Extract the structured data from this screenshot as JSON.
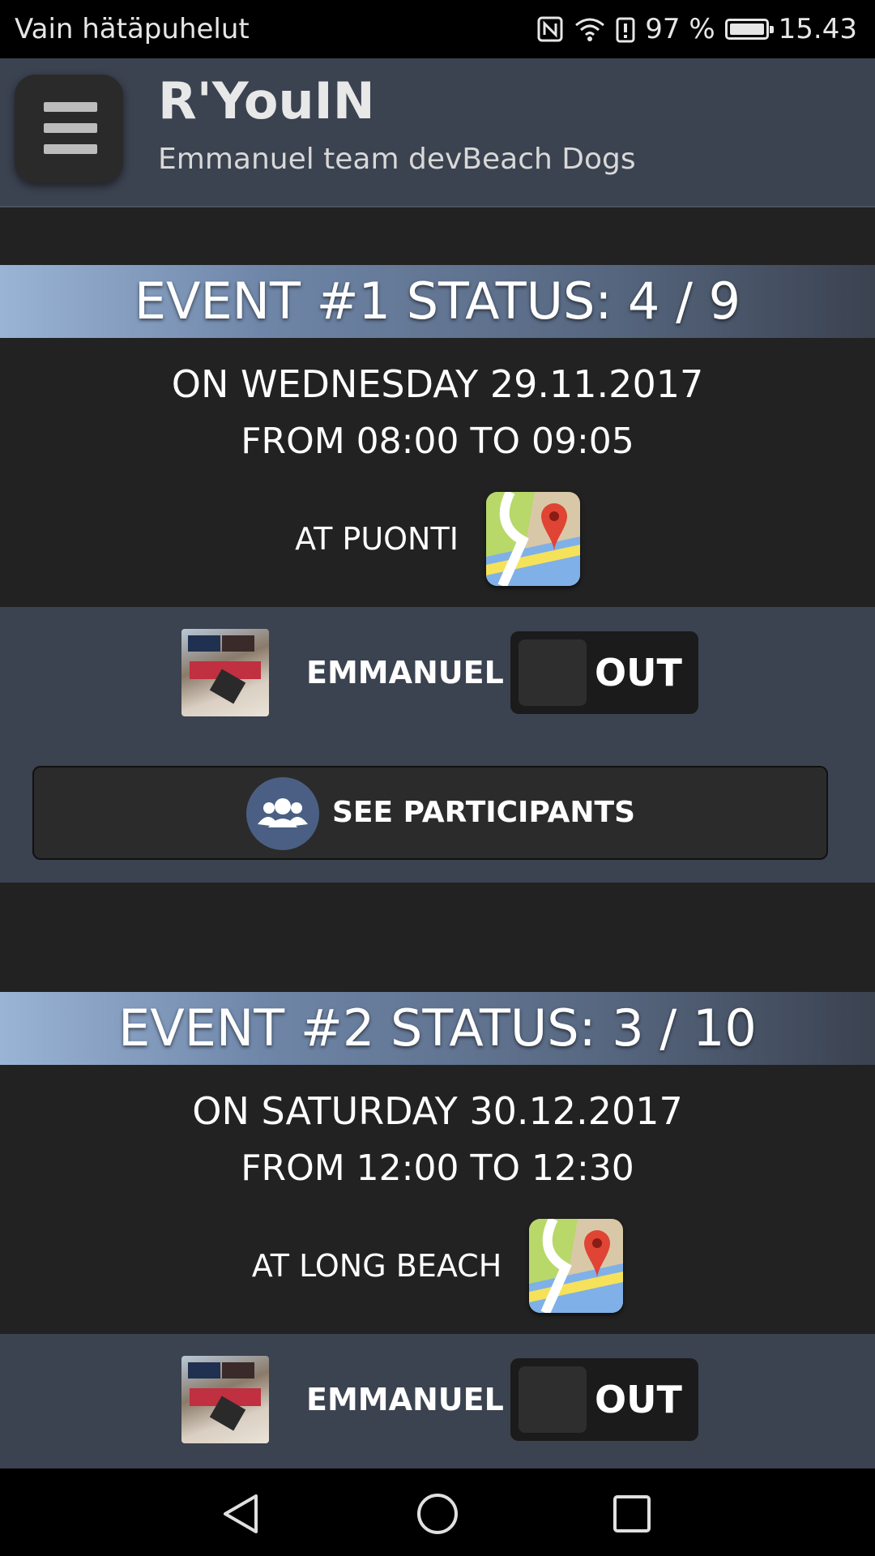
{
  "status_bar": {
    "carrier": "Vain hätäpuhelut",
    "battery": "97 %",
    "time": "15.43",
    "icons": [
      "nfc-icon",
      "wifi-icon",
      "battery-alert-icon",
      "battery-icon"
    ]
  },
  "header": {
    "app_title": "R'YouIN",
    "subtitle": "Emmanuel team devBeach Dogs",
    "menu_icon": "hamburger-menu-icon"
  },
  "events": [
    {
      "title": "EVENT #1 STATUS: 4 / 9",
      "date": "ON WEDNESDAY 29.11.2017",
      "time": "FROM 08:00 TO 09:05",
      "location": "AT PUONTI",
      "user_name": "EMMANUEL",
      "toggle_label": "OUT",
      "participants_label": "SEE PARTICIPANTS"
    },
    {
      "title": "EVENT #2 STATUS: 3 / 10",
      "date": "ON SATURDAY 30.12.2017",
      "time": "FROM 12:00 TO 12:30",
      "location": "AT LONG BEACH",
      "user_name": "EMMANUEL",
      "toggle_label": "OUT"
    }
  ],
  "nav_bar": {
    "buttons": [
      "back-icon",
      "home-icon",
      "recents-icon"
    ]
  },
  "colors": {
    "header_bg": "#3b4250",
    "page_bg": "#222222",
    "accent_blue": "#9ab4d6",
    "participants_circle": "#4a5f83"
  }
}
